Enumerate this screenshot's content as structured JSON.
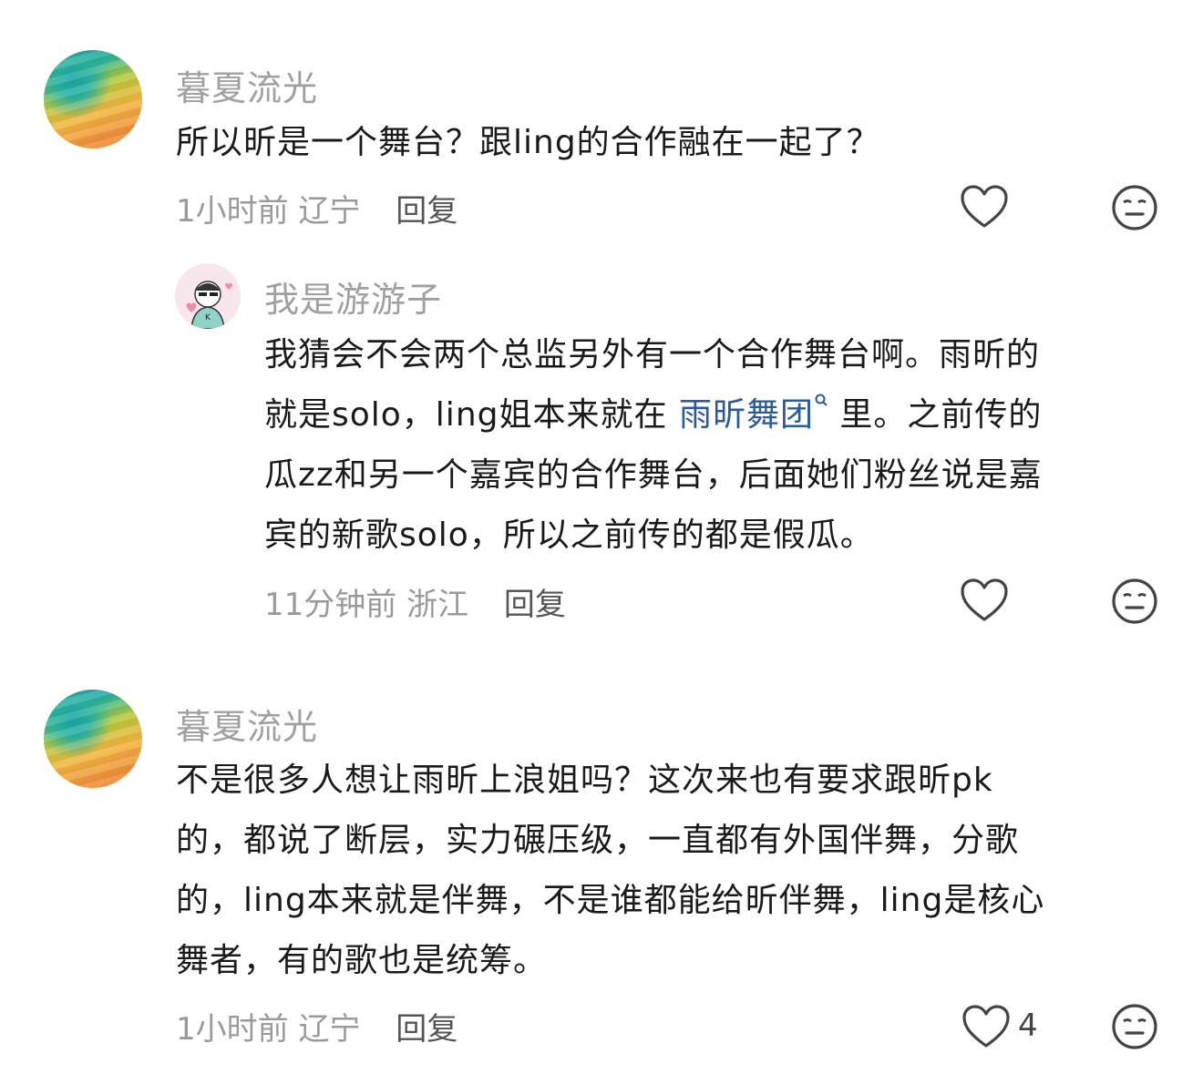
{
  "comments": [
    {
      "username": "暮夏流光",
      "text": "所以昕是一个舞台？跟ling的合作融在一起了？",
      "time": "1小时前",
      "location": "辽宁",
      "reply_label": "回复",
      "likes": ""
    },
    {
      "username": "我是游游子",
      "text_line1": "我猜会不会两个总监另外有一个合作舞台啊。雨昕的",
      "text_line2_pre": "就是solo，ling姐本来就在 ",
      "text_line2_link": "雨昕舞团",
      "text_line2_post": " 里。之前传的",
      "text_line3": "瓜zz和另一个嘉宾的合作舞台，后面她们粉丝说是嘉",
      "text_line4": "宾的新歌solo，所以之前传的都是假瓜。",
      "time": "11分钟前",
      "location": "浙江",
      "reply_label": "回复"
    },
    {
      "username": "暮夏流光",
      "text_lines": [
        "不是很多人想让雨昕上浪姐吗？这次来也有要求跟昕pk",
        "的，都说了断层，实力碾压级，一直都有外国伴舞，分歌",
        "的，ling本来就是伴舞，不是谁都能给昕伴舞，ling是核心",
        "舞者，有的歌也是统筹。"
      ],
      "time": "1小时前",
      "location": "辽宁",
      "reply_label": "回复",
      "likes": "4"
    }
  ],
  "icons": {
    "like": "heart-outline-icon",
    "dislike": "meh-face-icon",
    "search": "search-icon"
  },
  "colors": {
    "username": "#a0a0a0",
    "link": "#2a5a9e",
    "meta": "#9a9a9a"
  }
}
